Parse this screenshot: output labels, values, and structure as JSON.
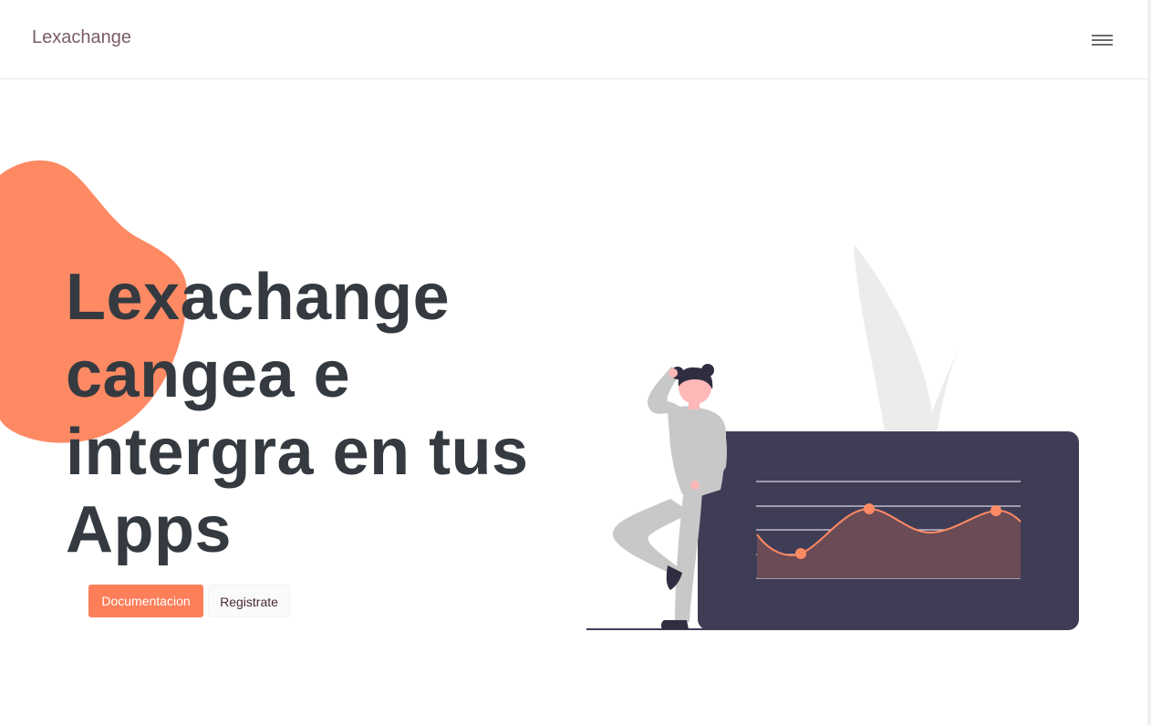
{
  "navbar": {
    "brand": "Lexachange",
    "menu_icon": "hamburger-menu-icon"
  },
  "hero": {
    "title": "Lexachange cangea e intergra en tus Apps",
    "buttons": {
      "docs_label": "Documentacion",
      "register_label": "Registrate"
    }
  },
  "colors": {
    "accent": "#fd7f5a",
    "blob": "#fe8a64",
    "heading": "#343a40",
    "panel": "#3f3d56",
    "chart_fill": "#6b4b55",
    "brand_text": "#7a5c64"
  },
  "illustration": {
    "name": "woman-leaning-on-chart-illustration"
  }
}
